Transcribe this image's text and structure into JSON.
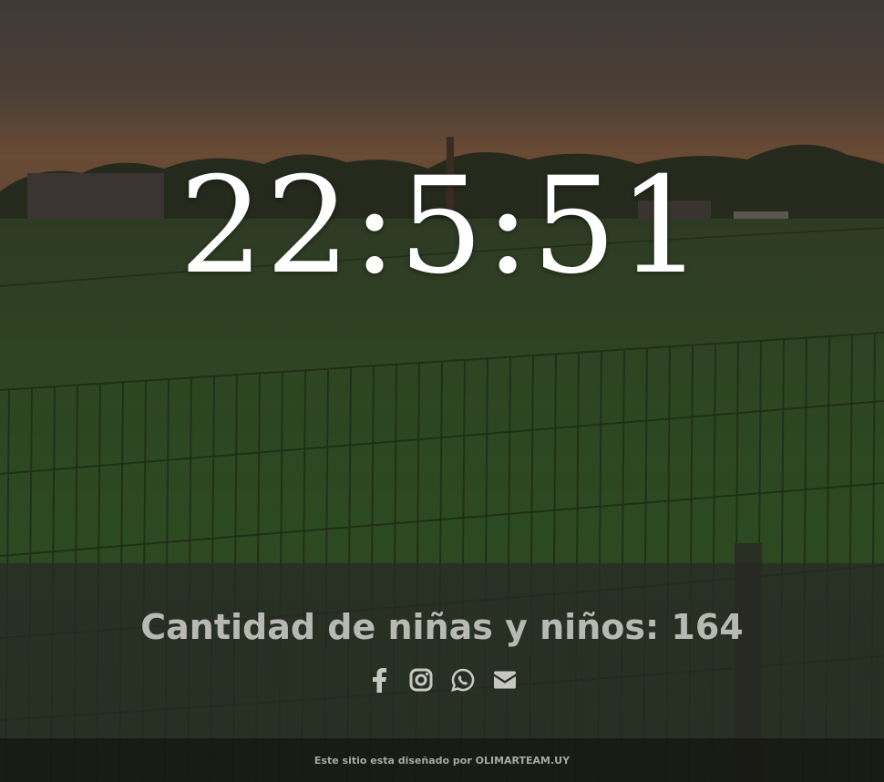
{
  "clock": {
    "time": "22:5:51"
  },
  "stats": {
    "count_text": "Cantidad de niñas y niños: 164"
  },
  "socials": [
    {
      "icon": "facebook-icon"
    },
    {
      "icon": "instagram-icon"
    },
    {
      "icon": "whatsapp-icon"
    },
    {
      "icon": "email-icon"
    }
  ],
  "footer": {
    "prefix": "Este sitio esta diseñado por",
    "link_label": "OLIMARTEAM.UY"
  },
  "colors": {
    "clock": "#ffffff",
    "count_text": "#b9b9b4",
    "icons": "#c8c8c3",
    "footer_text": "#a8a8a2"
  }
}
